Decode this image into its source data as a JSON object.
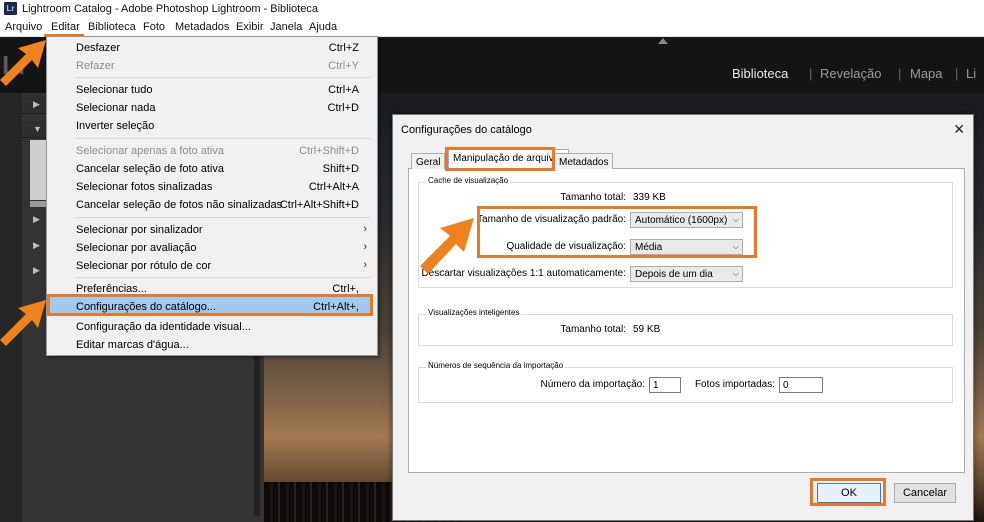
{
  "window": {
    "title": "Lightroom Catalog - Adobe Photoshop Lightroom - Biblioteca",
    "app_icon": "Lr"
  },
  "menubar": [
    "Arquivo",
    "Editar",
    "Biblioteca",
    "Foto",
    "Metadados",
    "Exibir",
    "Janela",
    "Ajuda"
  ],
  "lightroom": {
    "logo": "Lr",
    "modules": [
      "Biblioteca",
      "Revelação",
      "Mapa",
      "Li"
    ],
    "active_module": "Biblioteca"
  },
  "edit_menu": {
    "items": [
      {
        "label": "Desfazer",
        "shortcut": "Ctrl+Z",
        "disabled": false
      },
      {
        "label": "Refazer",
        "shortcut": "Ctrl+Y",
        "disabled": true
      },
      {
        "label": "Selecionar tudo",
        "shortcut": "Ctrl+A",
        "disabled": false
      },
      {
        "label": "Selecionar nada",
        "shortcut": "Ctrl+D",
        "disabled": false
      },
      {
        "label": "Inverter seleção",
        "shortcut": "",
        "disabled": false
      },
      {
        "label": "Selecionar apenas a foto ativa",
        "shortcut": "Ctrl+Shift+D",
        "disabled": true
      },
      {
        "label": "Cancelar seleção de foto ativa",
        "shortcut": "Shift+D",
        "disabled": false
      },
      {
        "label": "Selecionar fotos sinalizadas",
        "shortcut": "Ctrl+Alt+A",
        "disabled": false
      },
      {
        "label": "Cancelar seleção de fotos não sinalizadas",
        "shortcut": "Ctrl+Alt+Shift+D",
        "disabled": false
      },
      {
        "label": "Selecionar por sinalizador",
        "shortcut": "",
        "submenu": true
      },
      {
        "label": "Selecionar por avaliação",
        "shortcut": "",
        "submenu": true
      },
      {
        "label": "Selecionar por rótulo de cor",
        "shortcut": "",
        "submenu": true
      },
      {
        "label": "Preferências...",
        "shortcut": "Ctrl+,",
        "disabled": false
      },
      {
        "label": "Configurações do catálogo...",
        "shortcut": "Ctrl+Alt+,",
        "disabled": false,
        "highlighted": true
      },
      {
        "label": "Configuração da identidade visual...",
        "shortcut": "",
        "disabled": false
      },
      {
        "label": "Editar marcas d'água...",
        "shortcut": "",
        "disabled": false
      }
    ]
  },
  "dialog": {
    "title": "Configurações do catálogo",
    "close": "✕",
    "tabs": [
      "Geral",
      "Manipulação de arquivos",
      "Metadados"
    ],
    "active_tab": "Manipulação de arquivos",
    "cache": {
      "group_label": "Cache de visualização",
      "total_label": "Tamanho total:",
      "total_value": "339 KB",
      "size_label": "Tamanho de visualização padrão:",
      "size_value": "Automático (1600px)",
      "quality_label": "Qualidade de visualização:",
      "quality_value": "Média",
      "discard_label": "Descartar visualizações 1:1 automaticamente:",
      "discard_value": "Depois de um dia"
    },
    "smart": {
      "group_label": "Visualizações inteligentes",
      "total_label": "Tamanho total:",
      "total_value": "59 KB"
    },
    "import_seq": {
      "group_label": "Números de sequência da importação",
      "import_number_label": "Número da importação:",
      "import_number_value": "1",
      "imported_photos_label": "Fotos importadas:",
      "imported_photos_value": "0"
    },
    "ok_label": "OK",
    "cancel_label": "Cancelar"
  },
  "colors": {
    "highlight": "#e8782a",
    "menu_bg": "#f0f0f0",
    "lr_dark": "#151515",
    "selected_row": "#9fc9ef"
  },
  "icons": [
    "lightroom-app-icon",
    "close-icon",
    "chevron-down-icon",
    "submenu-arrow-icon",
    "orange-arrow-icon",
    "panel-triangle-icon"
  ]
}
